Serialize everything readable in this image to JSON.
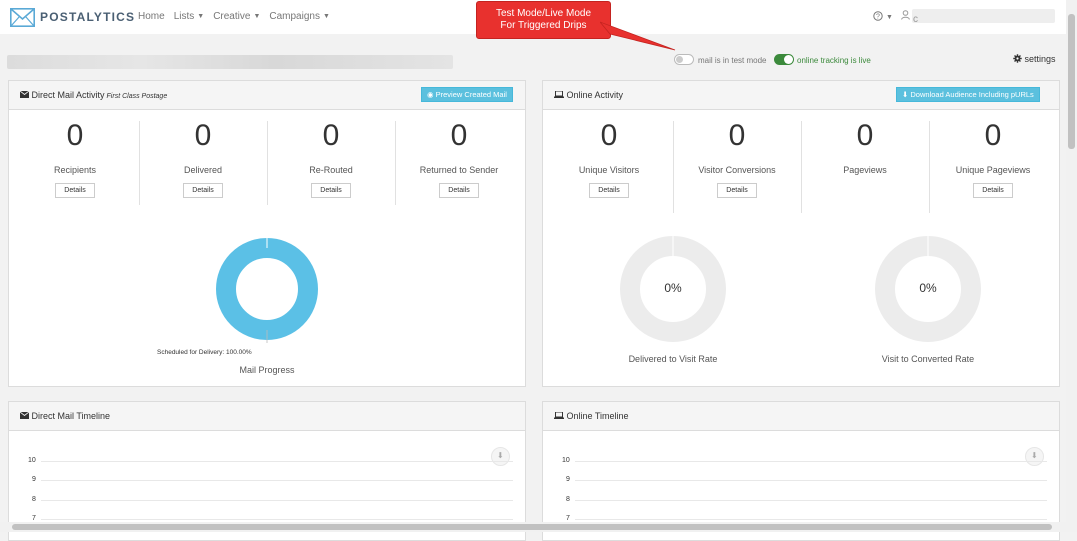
{
  "brand": {
    "name": "POSTALYTICS"
  },
  "nav": {
    "items": [
      {
        "label": "Home",
        "dropdown": false
      },
      {
        "label": "Lists",
        "dropdown": true
      },
      {
        "label": "Creative",
        "dropdown": true
      },
      {
        "label": "Campaigns",
        "dropdown": true
      }
    ],
    "user_initial": "c"
  },
  "callout": {
    "line1": "Test Mode/Live Mode",
    "line2": "For Triggered Drips"
  },
  "modes": {
    "test_label": "mail is in test mode",
    "live_label": "online tracking is live",
    "settings_label": "settings"
  },
  "direct_mail": {
    "title": "Direct Mail Activity",
    "subtitle": "First Class Postage",
    "button": "Preview Created Mail",
    "stats": [
      {
        "value": "0",
        "label": "Recipients",
        "details": "Details"
      },
      {
        "value": "0",
        "label": "Delivered",
        "details": "Details"
      },
      {
        "value": "0",
        "label": "Re-Routed",
        "details": "Details"
      },
      {
        "value": "0",
        "label": "Returned to Sender",
        "details": "Details"
      }
    ],
    "donut": {
      "segment_label": "Scheduled for Delivery: 100.00%",
      "caption": "Mail Progress",
      "fraction": 1.0,
      "color": "#5bc0e6"
    }
  },
  "online": {
    "title": "Online Activity",
    "button": "Download Audience Including pURLs",
    "stats": [
      {
        "value": "0",
        "label": "Unique Visitors",
        "details": "Details"
      },
      {
        "value": "0",
        "label": "Visitor Conversions",
        "details": "Details"
      },
      {
        "value": "0",
        "label": "Pageviews",
        "details": ""
      },
      {
        "value": "0",
        "label": "Unique Pageviews",
        "details": "Details"
      }
    ],
    "donuts": [
      {
        "center": "0%",
        "caption": "Delivered to Visit Rate"
      },
      {
        "center": "0%",
        "caption": "Visit to Converted Rate"
      }
    ]
  },
  "timelines": {
    "direct_mail_title": "Direct Mail Timeline",
    "online_title": "Online Timeline",
    "y_ticks": [
      "10",
      "9",
      "8",
      "7"
    ]
  },
  "colors": {
    "accent": "#5bc0de",
    "toggle_on": "#3c8a3c",
    "callout": "#e8312e"
  }
}
